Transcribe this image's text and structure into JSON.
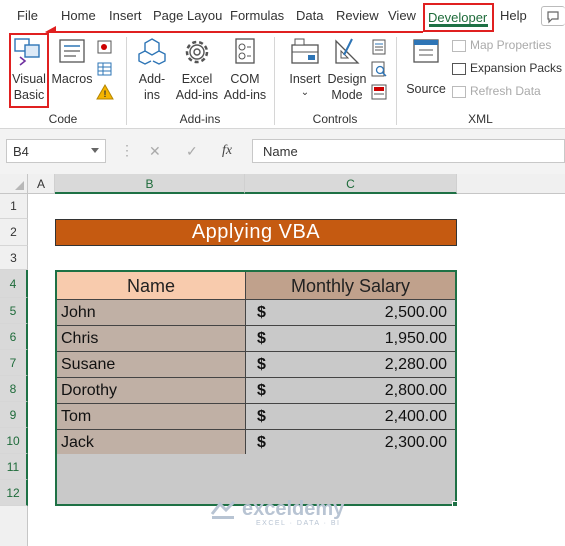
{
  "menu": {
    "tabs": [
      "File",
      "Home",
      "Insert",
      "Page Layou",
      "Formulas",
      "Data",
      "Review",
      "View",
      "Developer",
      "Help"
    ]
  },
  "ribbon": {
    "code_group": {
      "label": "Code",
      "visual_basic": [
        "Visual",
        "Basic"
      ],
      "macros": "Macros"
    },
    "addins_group": {
      "label": "Add-ins",
      "addins": [
        "Add-",
        "ins"
      ],
      "excel_addins": [
        "Excel",
        "Add-ins"
      ],
      "com_addins": [
        "COM",
        "Add-ins"
      ]
    },
    "controls_group": {
      "label": "Controls",
      "insert": "Insert",
      "design_mode": [
        "Design",
        "Mode"
      ]
    },
    "xml_group": {
      "label": "XML",
      "source": "Source",
      "map_properties": "Map Properties",
      "expansion_packs": "Expansion Packs",
      "refresh_data": "Refresh Data"
    }
  },
  "formula_bar": {
    "name_box": "B4",
    "cancel": "✕",
    "enter": "✓",
    "fx": "fx",
    "content": "Name"
  },
  "grid": {
    "columns": [
      "A",
      "B",
      "C"
    ],
    "rows": [
      "1",
      "2",
      "3",
      "4",
      "5",
      "6",
      "7",
      "8",
      "9",
      "10",
      "11",
      "12"
    ],
    "title": "Applying VBA",
    "headers": [
      "Name",
      "Monthly Salary"
    ],
    "records": [
      {
        "name": "John",
        "currency": "$",
        "amount": "2,500.00"
      },
      {
        "name": "Chris",
        "currency": "$",
        "amount": "1,950.00"
      },
      {
        "name": "Susane",
        "currency": "$",
        "amount": "2,280.00"
      },
      {
        "name": "Dorothy",
        "currency": "$",
        "amount": "2,800.00"
      },
      {
        "name": "Tom",
        "currency": "$",
        "amount": "2,400.00"
      },
      {
        "name": "Jack",
        "currency": "$",
        "amount": "2,300.00"
      }
    ]
  },
  "watermark": {
    "name": "exceldemy",
    "tagline": "EXCEL · DATA · BI"
  },
  "colors": {
    "accent_green": "#1e7145",
    "highlight_red": "#e02020",
    "title_fill": "#c55a11",
    "header_name_fill": "#f8cbad",
    "header_salary_fill": "#c0a18c"
  }
}
